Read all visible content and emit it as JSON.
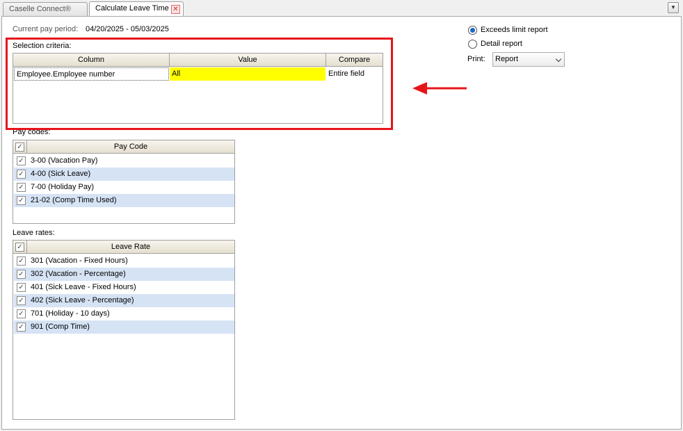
{
  "tabs": [
    {
      "label": "Caselle Connect®"
    },
    {
      "label": "Calculate Leave Time"
    }
  ],
  "pay_period": {
    "label": "Current pay period:",
    "value": "04/20/2025 - 05/03/2025"
  },
  "selection_criteria": {
    "label": "Selection criteria:",
    "columns": [
      "Column",
      "Value",
      "Compare"
    ],
    "rows": [
      {
        "column": "Employee.Employee number",
        "value": "All",
        "compare": "Entire field"
      }
    ]
  },
  "pay_codes": {
    "label": "Pay codes:",
    "header": "Pay Code",
    "items": [
      {
        "label": "3-00 (Vacation Pay)",
        "checked": true
      },
      {
        "label": "4-00 (Sick Leave)",
        "checked": true
      },
      {
        "label": "7-00 (Holiday Pay)",
        "checked": true
      },
      {
        "label": "21-02 (Comp Time Used)",
        "checked": true
      }
    ]
  },
  "leave_rates": {
    "label": "Leave rates:",
    "header": "Leave Rate",
    "items": [
      {
        "label": "301 (Vacation - Fixed Hours)",
        "checked": true
      },
      {
        "label": "302 (Vacation - Percentage)",
        "checked": true
      },
      {
        "label": "401 (Sick Leave - Fixed Hours)",
        "checked": true
      },
      {
        "label": "402 (Sick Leave - Percentage)",
        "checked": true
      },
      {
        "label": "701 (Holiday - 10 days)",
        "checked": true
      },
      {
        "label": "901 (Comp Time)",
        "checked": true
      }
    ]
  },
  "report_options": {
    "exceeds_limit": {
      "label": "Exceeds limit report",
      "selected": true
    },
    "detail": {
      "label": "Detail report",
      "selected": false
    },
    "print_label": "Print:",
    "print_value": "Report"
  },
  "icons": {
    "check": "✓",
    "close": "✕",
    "menu": "▼"
  },
  "colors": {
    "highlight": "#ffff00",
    "annotation": "#e8141b",
    "alt_row": "#d6e3f5"
  }
}
